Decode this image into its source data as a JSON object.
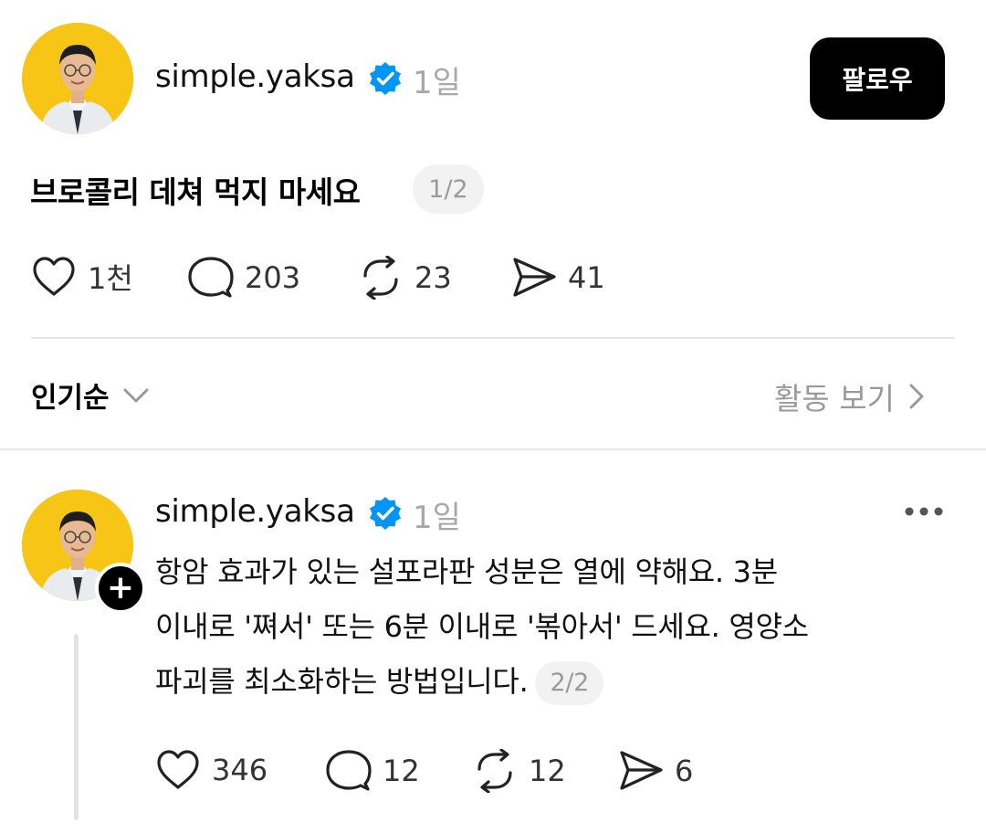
{
  "post": {
    "username": "simple.yaksa",
    "time": "1일",
    "follow_label": "팔로우",
    "text": "브로콜리 데쳐 먹지 마세요",
    "page_indicator": "1/2",
    "actions": {
      "likes": "1천",
      "comments": "203",
      "reposts": "23",
      "shares": "41"
    }
  },
  "sort_bar": {
    "sort_label": "인기순",
    "activity_label": "활동 보기"
  },
  "reply": {
    "username": "simple.yaksa",
    "time": "1일",
    "lines": [
      "항암 효과가 있는 설포라판 성분은 열에 약해요. 3분",
      "이내로 '쪄서' 또는 6분 이내로 '볶아서' 드세요. 영양소",
      "파괴를 최소화하는 방법입니다."
    ],
    "page_indicator": "2/2",
    "actions": {
      "likes": "346",
      "comments": "12",
      "reposts": "12",
      "shares": "6"
    }
  },
  "colors": {
    "avatar_bg": "#f7c515",
    "verified_blue": "#0095f6",
    "muted_text": "#9a9a9a"
  }
}
